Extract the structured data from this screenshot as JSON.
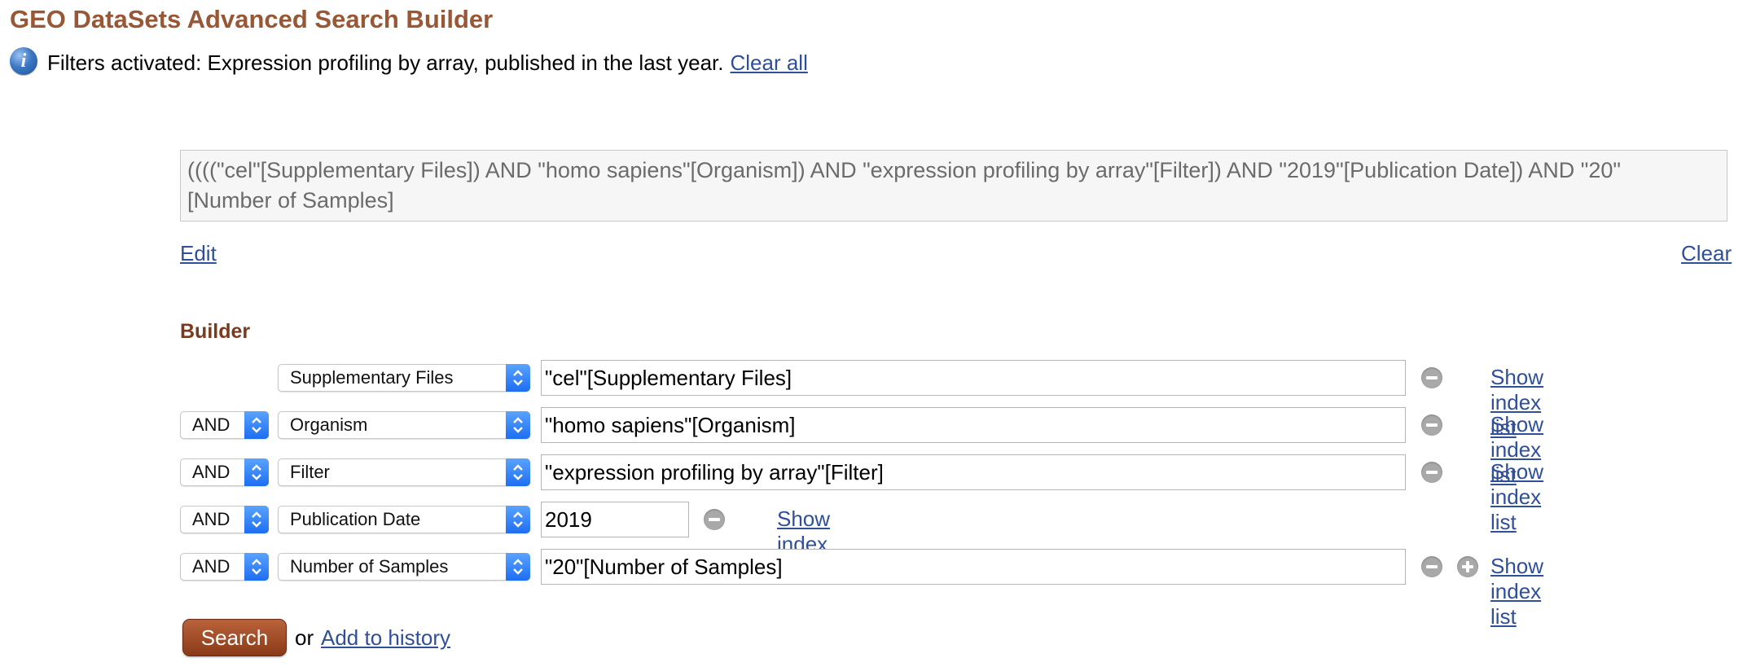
{
  "page": {
    "title": "GEO DataSets Advanced Search Builder"
  },
  "filters": {
    "text": "Filters activated: Expression profiling by array, published in the last year.",
    "clear_all_label": "Clear all",
    "info_icon": "info-icon"
  },
  "query": {
    "text": "((((\"cel\"[Supplementary Files]) AND \"homo sapiens\"[Organism]) AND \"expression profiling by array\"[Filter]) AND \"2019\"[Publication Date]) AND \"20\"\n[Number of Samples]",
    "edit_label": "Edit",
    "clear_label": "Clear"
  },
  "builder": {
    "label": "Builder",
    "rows": [
      {
        "operator": "",
        "field": "Supplementary Files",
        "value": "\"cel\"[Supplementary Files]",
        "index_label": "Show index list"
      },
      {
        "operator": "AND",
        "field": "Organism",
        "value": "\"homo sapiens\"[Organism]",
        "index_label": "Show index list"
      },
      {
        "operator": "AND",
        "field": "Filter",
        "value": "\"expression profiling by array\"[Filter]",
        "index_label": "Show index list"
      },
      {
        "operator": "AND",
        "field": "Publication Date",
        "value": "2019",
        "index_label": "Show index list"
      },
      {
        "operator": "AND",
        "field": "Number of Samples",
        "value": "\"20\"[Number of Samples]",
        "index_label": "Show index list"
      }
    ]
  },
  "actions": {
    "search_label": "Search",
    "or_text": "or",
    "add_history_label": "Add to history"
  },
  "colors": {
    "title": "#985735",
    "builder_label": "#7a3b1c",
    "link": "#2f4f99",
    "search_button": "#a04d27"
  }
}
